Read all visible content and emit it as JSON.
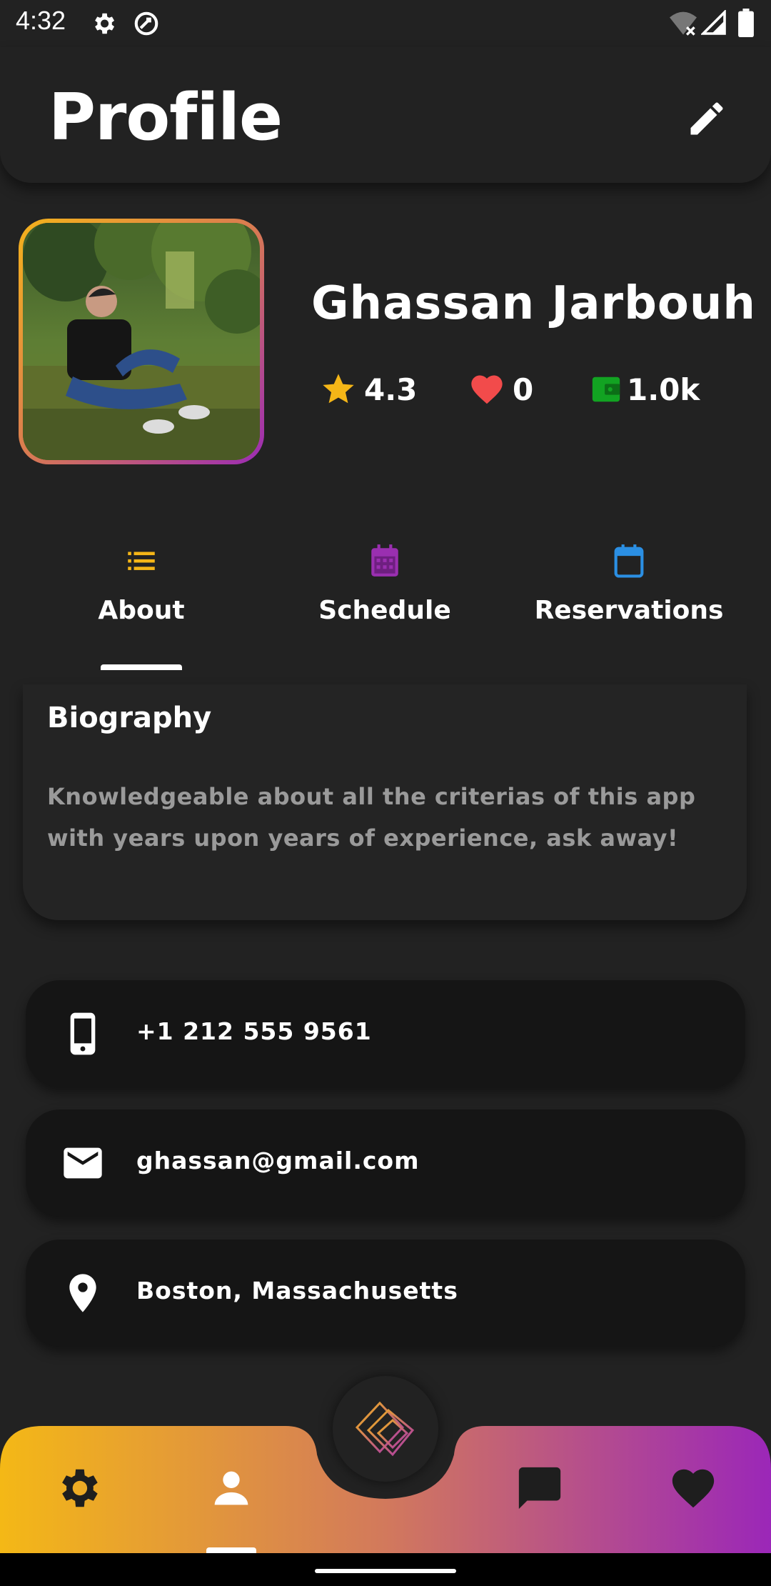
{
  "status_bar": {
    "time": "4:32",
    "icons": [
      "settings-icon",
      "sync-icon",
      "wifi-off-icon",
      "signal-icon",
      "battery-icon"
    ]
  },
  "header": {
    "title": "Profile",
    "edit_icon": "pencil-icon"
  },
  "profile": {
    "name": "Ghassan Jarbouh",
    "avatar": "photo of man sitting on grass",
    "stats": {
      "rating": "4.3",
      "likes": "0",
      "wallet": "1.0k"
    }
  },
  "tabs": [
    {
      "label": "About",
      "icon": "list-icon",
      "active": true
    },
    {
      "label": "Schedule",
      "icon": "calendar-grid-icon",
      "active": false
    },
    {
      "label": "Reservations",
      "icon": "calendar-icon",
      "active": false
    }
  ],
  "biography": {
    "title": "Biography",
    "text": "Knowledgeable about all the criterias of this app with years upon years of experience, ask away!"
  },
  "contacts": [
    {
      "icon": "phone-icon",
      "text": "+1 212 555 9561"
    },
    {
      "icon": "mail-icon",
      "text": "ghassan@gmail.com"
    },
    {
      "icon": "location-pin-icon",
      "text": "Boston, Massachusetts"
    }
  ],
  "bottom_nav": {
    "items": [
      "settings-icon",
      "person-icon",
      "home-logo-icon",
      "chat-icon",
      "heart-icon"
    ],
    "active": "person-icon"
  },
  "colors": {
    "background": "#222222",
    "gradient_start": "#f4b21b",
    "gradient_end": "#9b2bb5",
    "star": "#f5b617",
    "heart": "#f24b4b",
    "wallet": "#12a322",
    "schedule_icon": "#9a2fb0",
    "reservations_icon": "#2b8fe3"
  }
}
